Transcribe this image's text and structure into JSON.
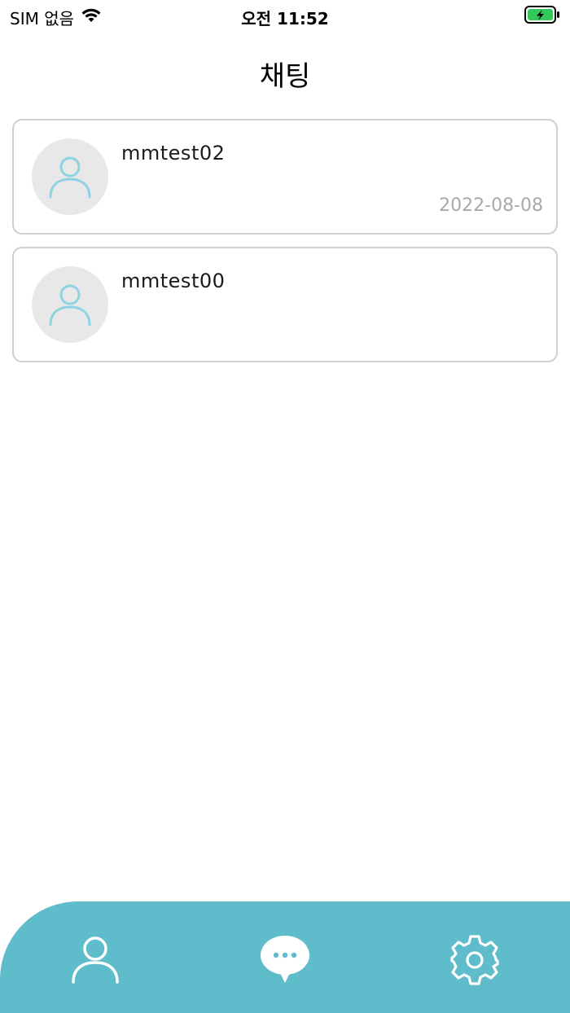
{
  "status_bar": {
    "carrier": "SIM 없음",
    "time": "오전 11:52",
    "battery_color": "#34c759"
  },
  "header": {
    "title": "채팅"
  },
  "chats": [
    {
      "name": "mmtest02",
      "date": "2022-08-08"
    },
    {
      "name": "mmtest00",
      "date": ""
    }
  ],
  "tab_bar": {
    "background_color": "#5fbccb",
    "tabs": [
      {
        "icon": "person-icon"
      },
      {
        "icon": "chat-bubble-icon"
      },
      {
        "icon": "gear-icon"
      }
    ]
  },
  "colors": {
    "avatar_bg": "#e8e8e8",
    "avatar_icon": "#8fd3e3",
    "date_text": "#a9a9a9"
  }
}
